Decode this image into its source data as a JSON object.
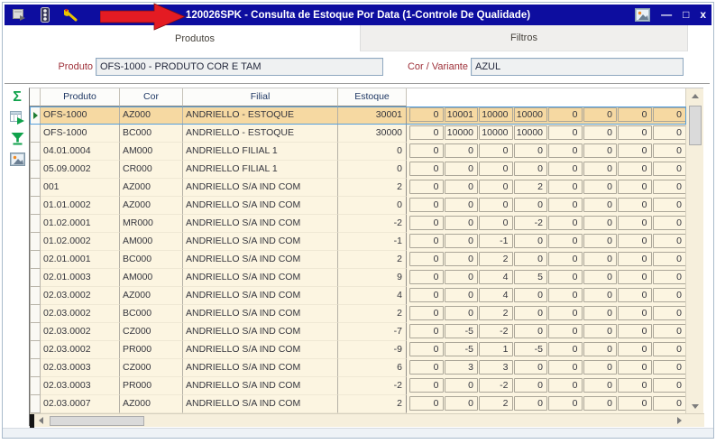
{
  "titlebar": {
    "title": "120026SPK - Consulta de Estoque Por Data (1-Controle De Qualidade)",
    "minimize": "—",
    "maximize": "□",
    "close": "x",
    "icons": [
      "system-menu-icon",
      "traffic-light-icon",
      "wrench-icon",
      "picture-icon"
    ]
  },
  "annotation": {
    "shape": "red-arrow-pointing-right"
  },
  "tabs": {
    "produtos": "Produtos",
    "filtros": "Filtros"
  },
  "filters": {
    "produto_label": "Produto",
    "produto_value": "OFS-1000 - PRODUTO COR E TAM",
    "cor_label": "Cor / Variante",
    "cor_value": "AZUL"
  },
  "toolbar_icons": [
    "sum-icon",
    "export-grid-icon",
    "filter-funnel-icon",
    "image-icon"
  ],
  "grid": {
    "columns": [
      "Produto",
      "Cor",
      "Filial",
      "Estoque"
    ],
    "rows": [
      {
        "produto": "OFS-1000",
        "cor": "AZ000",
        "filial": "ANDRIELLO - ESTOQUE",
        "estoque": "30001",
        "values": [
          "0",
          "10001",
          "10000",
          "10000",
          "0",
          "0",
          "0",
          "0"
        ],
        "selected": true
      },
      {
        "produto": "OFS-1000",
        "cor": "BC000",
        "filial": "ANDRIELLO - ESTOQUE",
        "estoque": "30000",
        "values": [
          "0",
          "10000",
          "10000",
          "10000",
          "0",
          "0",
          "0",
          "0"
        ],
        "selected": false
      },
      {
        "produto": "04.01.0004",
        "cor": "AM000",
        "filial": "ANDRIELLO FILIAL 1",
        "estoque": "0",
        "values": [
          "0",
          "0",
          "0",
          "0",
          "0",
          "0",
          "0",
          "0"
        ],
        "selected": false
      },
      {
        "produto": "05.09.0002",
        "cor": "CR000",
        "filial": "ANDRIELLO FILIAL 1",
        "estoque": "0",
        "values": [
          "0",
          "0",
          "0",
          "0",
          "0",
          "0",
          "0",
          "0"
        ],
        "selected": false
      },
      {
        "produto": "001",
        "cor": "AZ000",
        "filial": "ANDRIELLO S/A IND COM",
        "estoque": "2",
        "values": [
          "0",
          "0",
          "0",
          "2",
          "0",
          "0",
          "0",
          "0"
        ],
        "selected": false
      },
      {
        "produto": "01.01.0002",
        "cor": "AZ000",
        "filial": "ANDRIELLO S/A IND COM",
        "estoque": "0",
        "values": [
          "0",
          "0",
          "0",
          "0",
          "0",
          "0",
          "0",
          "0"
        ],
        "selected": false
      },
      {
        "produto": "01.02.0001",
        "cor": "MR000",
        "filial": "ANDRIELLO S/A IND COM",
        "estoque": "-2",
        "values": [
          "0",
          "0",
          "0",
          "-2",
          "0",
          "0",
          "0",
          "0"
        ],
        "selected": false
      },
      {
        "produto": "01.02.0002",
        "cor": "AM000",
        "filial": "ANDRIELLO S/A IND COM",
        "estoque": "-1",
        "values": [
          "0",
          "0",
          "-1",
          "0",
          "0",
          "0",
          "0",
          "0"
        ],
        "selected": false
      },
      {
        "produto": "02.01.0001",
        "cor": "BC000",
        "filial": "ANDRIELLO S/A IND COM",
        "estoque": "2",
        "values": [
          "0",
          "0",
          "2",
          "0",
          "0",
          "0",
          "0",
          "0"
        ],
        "selected": false
      },
      {
        "produto": "02.01.0003",
        "cor": "AM000",
        "filial": "ANDRIELLO S/A IND COM",
        "estoque": "9",
        "values": [
          "0",
          "0",
          "4",
          "5",
          "0",
          "0",
          "0",
          "0"
        ],
        "selected": false
      },
      {
        "produto": "02.03.0002",
        "cor": "AZ000",
        "filial": "ANDRIELLO S/A IND COM",
        "estoque": "4",
        "values": [
          "0",
          "0",
          "4",
          "0",
          "0",
          "0",
          "0",
          "0"
        ],
        "selected": false
      },
      {
        "produto": "02.03.0002",
        "cor": "BC000",
        "filial": "ANDRIELLO S/A IND COM",
        "estoque": "2",
        "values": [
          "0",
          "0",
          "2",
          "0",
          "0",
          "0",
          "0",
          "0"
        ],
        "selected": false
      },
      {
        "produto": "02.03.0002",
        "cor": "CZ000",
        "filial": "ANDRIELLO S/A IND COM",
        "estoque": "-7",
        "values": [
          "0",
          "-5",
          "-2",
          "0",
          "0",
          "0",
          "0",
          "0"
        ],
        "selected": false
      },
      {
        "produto": "02.03.0002",
        "cor": "PR000",
        "filial": "ANDRIELLO S/A IND COM",
        "estoque": "-9",
        "values": [
          "0",
          "-5",
          "1",
          "-5",
          "0",
          "0",
          "0",
          "0"
        ],
        "selected": false
      },
      {
        "produto": "02.03.0003",
        "cor": "CZ000",
        "filial": "ANDRIELLO S/A IND COM",
        "estoque": "6",
        "values": [
          "0",
          "3",
          "3",
          "0",
          "0",
          "0",
          "0",
          "0"
        ],
        "selected": false
      },
      {
        "produto": "02.03.0003",
        "cor": "PR000",
        "filial": "ANDRIELLO S/A IND COM",
        "estoque": "-2",
        "values": [
          "0",
          "0",
          "-2",
          "0",
          "0",
          "0",
          "0",
          "0"
        ],
        "selected": false
      },
      {
        "produto": "02.03.0007",
        "cor": "AZ000",
        "filial": "ANDRIELLO S/A IND COM",
        "estoque": "2",
        "values": [
          "0",
          "0",
          "2",
          "0",
          "0",
          "0",
          "0",
          "0"
        ],
        "selected": false
      }
    ]
  },
  "colors": {
    "titlebar_blue": "#0D0D9F",
    "row_cream": "#FCF5E1",
    "selected_row_tan": "#F6D9A2",
    "selection_blue": "#57A0DC",
    "label_maroon": "#9E3039",
    "header_navy": "#1F3864",
    "icon_green": "#10A24C",
    "arrow_red": "#E41B23"
  }
}
